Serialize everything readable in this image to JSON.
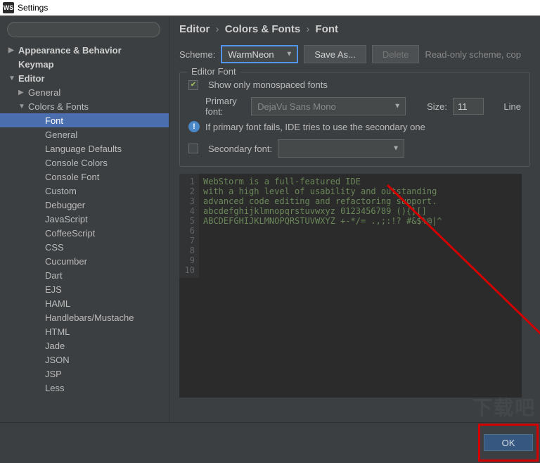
{
  "window": {
    "title": "Settings",
    "logo": "WS"
  },
  "sidebar": {
    "search_placeholder": "",
    "items": [
      {
        "label": "Appearance & Behavior",
        "bold": true,
        "arrow": "▶",
        "indent": 0
      },
      {
        "label": "Keymap",
        "bold": true,
        "arrow": "",
        "indent": 0
      },
      {
        "label": "Editor",
        "bold": true,
        "arrow": "▼",
        "indent": 0
      },
      {
        "label": "General",
        "arrow": "▶",
        "indent": 1
      },
      {
        "label": "Colors & Fonts",
        "arrow": "▼",
        "indent": 1
      },
      {
        "label": "Font",
        "indent": 2,
        "selected": true
      },
      {
        "label": "General",
        "indent": 2
      },
      {
        "label": "Language Defaults",
        "indent": 2
      },
      {
        "label": "Console Colors",
        "indent": 2
      },
      {
        "label": "Console Font",
        "indent": 2
      },
      {
        "label": "Custom",
        "indent": 2
      },
      {
        "label": "Debugger",
        "indent": 2
      },
      {
        "label": "JavaScript",
        "indent": 2
      },
      {
        "label": "CoffeeScript",
        "indent": 2
      },
      {
        "label": "CSS",
        "indent": 2
      },
      {
        "label": "Cucumber",
        "indent": 2
      },
      {
        "label": "Dart",
        "indent": 2
      },
      {
        "label": "EJS",
        "indent": 2
      },
      {
        "label": "HAML",
        "indent": 2
      },
      {
        "label": "Handlebars/Mustache",
        "indent": 2
      },
      {
        "label": "HTML",
        "indent": 2
      },
      {
        "label": "Jade",
        "indent": 2
      },
      {
        "label": "JSON",
        "indent": 2
      },
      {
        "label": "JSP",
        "indent": 2
      },
      {
        "label": "Less",
        "indent": 2
      }
    ]
  },
  "breadcrumb": {
    "a": "Editor",
    "b": "Colors & Fonts",
    "c": "Font"
  },
  "scheme": {
    "label": "Scheme:",
    "value": "WarmNeon",
    "save_as": "Save As...",
    "delete": "Delete",
    "readonly": "Read-only scheme, cop"
  },
  "editor_font": {
    "group": "Editor Font",
    "monospaced": "Show only monospaced fonts",
    "primary_label": "Primary font:",
    "primary_value": "DejaVu Sans Mono",
    "size_label": "Size:",
    "size_value": "11",
    "line_label": "Line",
    "info": "If primary font fails, IDE tries to use the secondary one",
    "secondary_label": "Secondary font:",
    "secondary_value": ""
  },
  "preview": {
    "lines": [
      "WebStorm is a full-featured IDE",
      "with a high level of usability and outstanding",
      "advanced code editing and refactoring support.",
      "",
      "abcdefghijklmnopqrstuvwxyz 0123456789 (){}[]",
      "ABCDEFGHIJKLMNOPQRSTUVWXYZ +-*/= .,;:!? #&$%@|^",
      "",
      "",
      "",
      ""
    ]
  },
  "footer": {
    "ok": "OK"
  }
}
